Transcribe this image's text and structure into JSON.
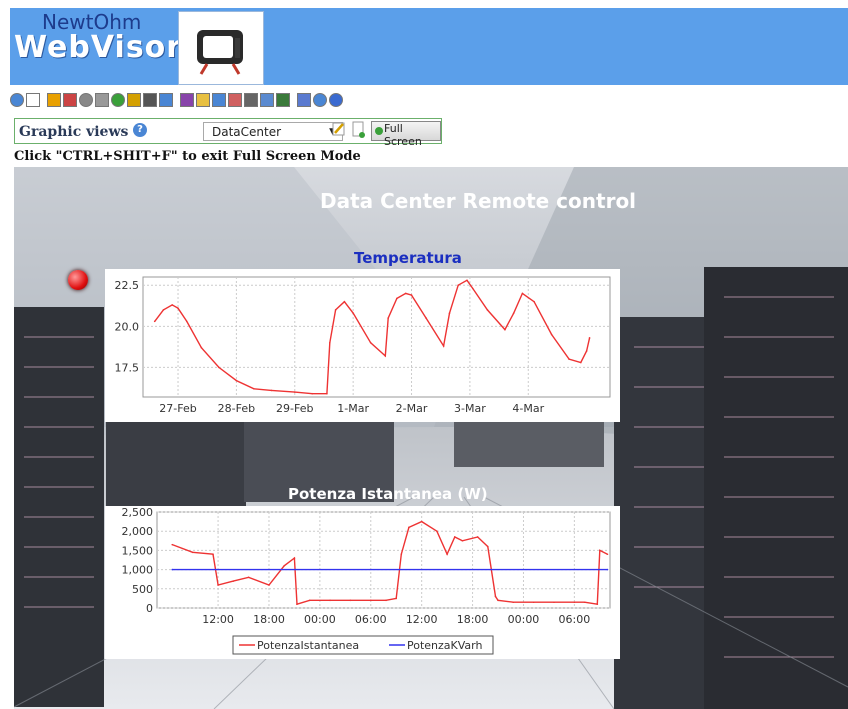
{
  "header": {
    "brand_small": "NewtOhm",
    "brand_big": "WebVisor"
  },
  "toolbar": {
    "icons": [
      "eye-icon",
      "blank-page-icon",
      "edit-icon",
      "list-icon",
      "gear-icon",
      "database-icon",
      "clock-icon",
      "hand-icon",
      "link-icon",
      "chart-icon",
      "users-icon",
      "folder-icon",
      "page-icon",
      "network-icon",
      "wrench-icon",
      "table-icon",
      "report-icon",
      "document-icon",
      "target-icon",
      "help-icon"
    ]
  },
  "graphic_views": {
    "label": "Graphic views",
    "selected": "DataCenter",
    "fullscreen_label": "Full Screen"
  },
  "hint": "Click \"CTRL+SHIT+F\" to exit Full Screen Mode",
  "scene": {
    "title": "Data Center Remote control",
    "temperature_title": "Temperatura",
    "power_title": "Potenza Istantanea (W)"
  },
  "colors": {
    "header": "#5b9fea",
    "series_red": "#ee3333",
    "series_blue": "#3333ee",
    "title_blue": "#1b2fc0"
  },
  "chart_data": [
    {
      "type": "line",
      "title": "Temperatura",
      "x_ticks": [
        "27-Feb",
        "28-Feb",
        "29-Feb",
        "1-Mar",
        "2-Mar",
        "3-Mar",
        "4-Mar"
      ],
      "y_ticks": [
        "17.5",
        "20.0",
        "22.5"
      ],
      "ylim": [
        15.7,
        23.0
      ],
      "xlim": [
        -0.6,
        7.4
      ],
      "grid": true,
      "series": [
        {
          "x": [
            -0.4,
            -0.25,
            -0.1,
            0.0,
            0.15,
            0.4,
            0.7,
            1.0,
            1.3,
            1.6,
            2.0,
            2.3,
            2.55,
            2.6,
            2.7,
            2.85,
            3.0,
            3.3,
            3.55,
            3.6,
            3.75,
            3.9,
            4.0,
            4.25,
            4.55,
            4.65,
            4.8,
            4.95,
            5.05,
            5.3,
            5.6,
            5.75,
            5.9,
            6.1,
            6.4,
            6.7,
            6.9,
            7.0,
            7.05
          ],
          "y": [
            20.3,
            21.0,
            21.3,
            21.1,
            20.3,
            18.7,
            17.5,
            16.7,
            16.2,
            16.1,
            16.0,
            15.9,
            15.9,
            19.0,
            21.0,
            21.5,
            20.8,
            19.0,
            18.2,
            20.5,
            21.7,
            22.0,
            21.9,
            20.5,
            18.8,
            20.8,
            22.5,
            22.8,
            22.3,
            21.0,
            19.8,
            20.8,
            22.0,
            21.5,
            19.5,
            18.0,
            17.8,
            18.5,
            19.3
          ]
        }
      ]
    },
    {
      "type": "line",
      "title": "Potenza Istantanea (W)",
      "x_ticks": [
        "12:00",
        "18:00",
        "00:00",
        "06:00",
        "12:00",
        "18:00",
        "00:00",
        "06:00"
      ],
      "y_ticks": [
        "0",
        "500",
        "1,000",
        "1,500",
        "2,000",
        "2,500"
      ],
      "ylim": [
        0,
        2500
      ],
      "xlim": [
        -1.2,
        7.7
      ],
      "grid": true,
      "legend": "bottom",
      "series": [
        {
          "name": "PotenzaIstantanea",
          "x": [
            -0.9,
            -0.5,
            -0.1,
            0.0,
            0.3,
            0.6,
            1.0,
            1.3,
            1.5,
            1.55,
            1.8,
            2.2,
            2.6,
            3.0,
            3.3,
            3.5,
            3.6,
            3.75,
            4.0,
            4.3,
            4.5,
            4.65,
            4.8,
            5.1,
            5.3,
            5.45,
            5.5,
            5.8,
            6.2,
            6.6,
            7.0,
            7.2,
            7.45,
            7.5,
            7.65
          ],
          "y": [
            1650,
            1450,
            1400,
            600,
            700,
            800,
            600,
            1100,
            1300,
            100,
            200,
            200,
            200,
            200,
            200,
            250,
            1400,
            2100,
            2250,
            2000,
            1400,
            1850,
            1750,
            1850,
            1600,
            300,
            200,
            150,
            150,
            150,
            150,
            150,
            100,
            1500,
            1400
          ]
        },
        {
          "name": "PotenzaKVarh",
          "x": [
            -0.9,
            7.65
          ],
          "y": [
            1000,
            1000
          ]
        }
      ]
    }
  ]
}
